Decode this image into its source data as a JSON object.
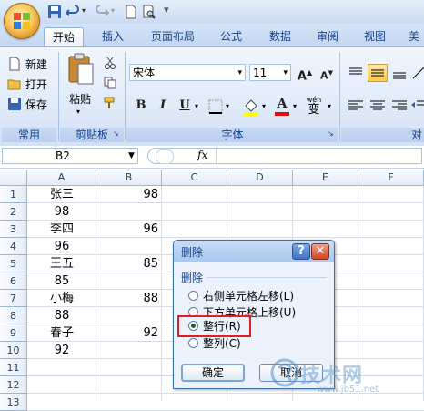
{
  "tabs": [
    "开始",
    "插入",
    "页面布局",
    "公式",
    "数据",
    "审阅",
    "视图",
    "美"
  ],
  "active_tab": 0,
  "ribbon": {
    "clipboard": {
      "paste_label": "粘贴",
      "new_label": "新建",
      "open_label": "打开",
      "save_label": "保存"
    },
    "group_labels": [
      "常用",
      "剪贴板",
      "字体",
      "对"
    ],
    "font_name": "宋体",
    "font_size": "11",
    "bold": "B",
    "italic": "I",
    "underline": "U",
    "phonetic": "wén",
    "phonetic_char": "变"
  },
  "formula_bar": {
    "name_box": "B2",
    "fx": "fx"
  },
  "grid": {
    "columns": [
      "A",
      "B",
      "C",
      "D",
      "E",
      "F"
    ],
    "rows": [
      "1",
      "2",
      "3",
      "4",
      "5",
      "6",
      "7",
      "8",
      "9",
      "10",
      "11",
      "12",
      "13"
    ],
    "cells": [
      {
        "row": 1,
        "col": "A",
        "value": "张三"
      },
      {
        "row": 1,
        "col": "B",
        "value": "98"
      },
      {
        "row": 2,
        "col": "A",
        "value": "98"
      },
      {
        "row": 3,
        "col": "A",
        "value": "李四"
      },
      {
        "row": 3,
        "col": "B",
        "value": "96"
      },
      {
        "row": 4,
        "col": "A",
        "value": "96"
      },
      {
        "row": 5,
        "col": "A",
        "value": "王五"
      },
      {
        "row": 5,
        "col": "B",
        "value": "85"
      },
      {
        "row": 6,
        "col": "A",
        "value": "85"
      },
      {
        "row": 7,
        "col": "A",
        "value": "小梅"
      },
      {
        "row": 7,
        "col": "B",
        "value": "88"
      },
      {
        "row": 8,
        "col": "A",
        "value": "88"
      },
      {
        "row": 9,
        "col": "A",
        "value": "春子"
      },
      {
        "row": 9,
        "col": "B",
        "value": "92"
      },
      {
        "row": 10,
        "col": "A",
        "value": "92"
      }
    ]
  },
  "dialog": {
    "title": "删除",
    "help": "?",
    "close": "✕",
    "group_label": "删除",
    "options": [
      {
        "label": "右侧单元格左移(L)",
        "selected": false
      },
      {
        "label": "下方单元格上移(U)",
        "selected": false
      },
      {
        "label": "整行(R)",
        "selected": true
      },
      {
        "label": "整列(C)",
        "selected": false
      }
    ],
    "ok_label": "确定",
    "cancel_label": "取消"
  },
  "watermark": {
    "main": "技术网",
    "sub": "www.jb51.net"
  }
}
